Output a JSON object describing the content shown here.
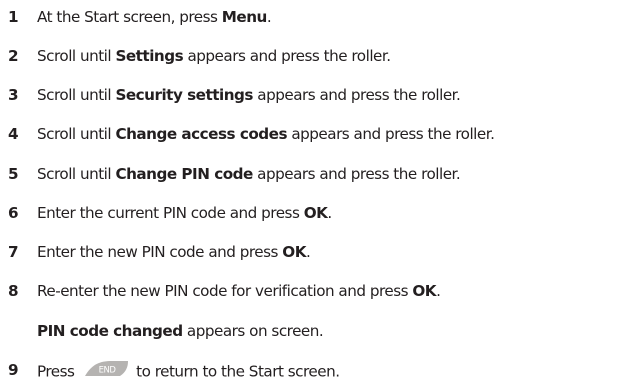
{
  "steps": [
    {
      "num": "1",
      "pre": "At the Start screen, press ",
      "bold": "Menu",
      "post": "."
    },
    {
      "num": "2",
      "pre": "Scroll until ",
      "bold": "Settings",
      "post": " appears and press the roller."
    },
    {
      "num": "3",
      "pre": "Scroll until ",
      "bold": "Security settings",
      "post": " appears and press the roller."
    },
    {
      "num": "4",
      "pre": "Scroll until ",
      "bold": "Change access codes",
      "post": " appears and press the roller."
    },
    {
      "num": "5",
      "pre": "Scroll until ",
      "bold": "Change PIN code",
      "post": " appears and press the roller."
    },
    {
      "num": "6",
      "pre": "Enter the current PIN code and press ",
      "bold": "OK",
      "post": "."
    },
    {
      "num": "7",
      "pre": "Enter the new PIN code and press ",
      "bold": "OK",
      "post": "."
    },
    {
      "num": "8",
      "pre": "Re-enter the new PIN code for verification and press ",
      "bold": "OK",
      "post": "."
    },
    {
      "num": "9",
      "pre": "Press ",
      "key": "END",
      "post": " to return to the Start screen."
    }
  ],
  "step8_result": {
    "bold": "PIN code changed",
    "post": " appears on screen."
  },
  "end_key": {
    "label": "END",
    "icon": "end-key-icon",
    "fill_color": "#b5b3b1",
    "text_color": "#ffffff"
  }
}
